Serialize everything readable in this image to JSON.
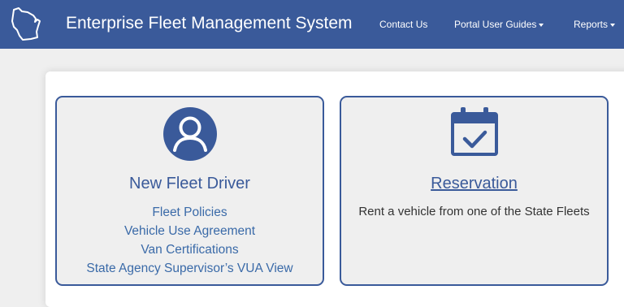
{
  "header": {
    "title": "Enterprise Fleet Management System",
    "logo_icon": "wisconsin-state-outline-icon",
    "nav": [
      {
        "label": "Contact Us",
        "dropdown": false
      },
      {
        "label": "Portal User Guides",
        "dropdown": true
      },
      {
        "label": "Reports",
        "dropdown": true
      }
    ]
  },
  "cards": {
    "driver": {
      "icon": "user-avatar-icon",
      "title": "New Fleet Driver",
      "links": [
        "Fleet Policies",
        "Vehicle Use Agreement",
        "Van Certifications",
        "State Agency Supervisor’s VUA View"
      ]
    },
    "reservation": {
      "icon": "calendar-check-icon",
      "title": "Reservation",
      "description": "Rent a vehicle from one of the State Fleets"
    }
  },
  "colors": {
    "navbar": "#3a5a9a",
    "accent": "#3a5a9a",
    "link": "#3a6aa8",
    "background": "#efefef",
    "panel": "#ffffff"
  }
}
